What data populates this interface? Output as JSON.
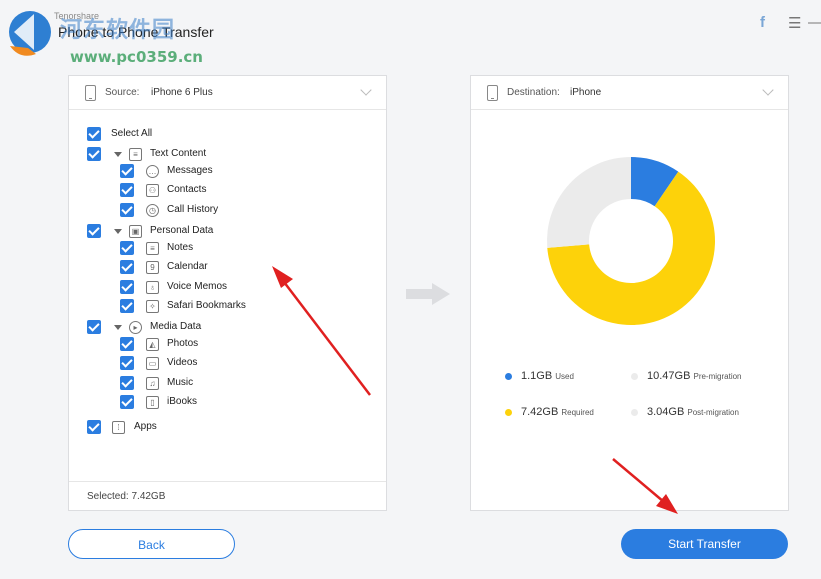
{
  "app": {
    "brand": "Tenorshare",
    "title": "Phone to Phone Transfer",
    "watermark_cn": "河东软件园",
    "watermark_url": "www.pc0359.cn"
  },
  "window_controls": {
    "facebook_glyph": "f",
    "menu_glyph": "☰",
    "minimize_glyph": "—"
  },
  "source": {
    "label": "Source:",
    "device": "iPhone 6 Plus",
    "select_all": "Select All",
    "groups": [
      {
        "label": "Text Content",
        "icon": "document-icon",
        "items": [
          {
            "label": "Messages",
            "icon": "chat-bubble-icon"
          },
          {
            "label": "Contacts",
            "icon": "person-icon"
          },
          {
            "label": "Call History",
            "icon": "clock-icon"
          }
        ]
      },
      {
        "label": "Personal Data",
        "icon": "id-card-icon",
        "items": [
          {
            "label": "Notes",
            "icon": "notes-icon"
          },
          {
            "label": "Calendar",
            "icon": "calendar-icon"
          },
          {
            "label": "Voice Memos",
            "icon": "microphone-icon"
          },
          {
            "label": "Safari Bookmarks",
            "icon": "compass-icon"
          }
        ]
      },
      {
        "label": "Media Data",
        "icon": "play-icon",
        "items": [
          {
            "label": "Photos",
            "icon": "photo-icon"
          },
          {
            "label": "Videos",
            "icon": "video-camera-icon"
          },
          {
            "label": "Music",
            "icon": "music-note-icon"
          },
          {
            "label": "iBooks",
            "icon": "book-icon"
          }
        ]
      }
    ],
    "apps": {
      "label": "Apps",
      "icon": "apps-grid-icon"
    },
    "selected_text": "Selected: 7.42GB"
  },
  "destination": {
    "label": "Destination:",
    "device": "iPhone"
  },
  "storage": {
    "segments": [
      {
        "name": "Used",
        "value_gb": 1.1,
        "color": "#2b7de0"
      },
      {
        "name": "Required",
        "value_gb": 7.42,
        "color": "#fdd20a"
      },
      {
        "name": "Free",
        "value_gb": 3.04,
        "color": "#ebebeb"
      }
    ],
    "legend": [
      {
        "value": "1.1GB",
        "label": "Used",
        "color": "#2b7de0"
      },
      {
        "value": "10.47GB",
        "label": "Pre-migration",
        "color": "#ebebeb"
      },
      {
        "value": "7.42GB",
        "label": "Required",
        "color": "#fdd20a"
      },
      {
        "value": "3.04GB",
        "label": "Post-migration",
        "color": "#ebebeb"
      }
    ]
  },
  "buttons": {
    "back": "Back",
    "start": "Start Transfer"
  },
  "colors": {
    "accent": "#2b7de0",
    "annotation_arrow": "#e02020"
  }
}
